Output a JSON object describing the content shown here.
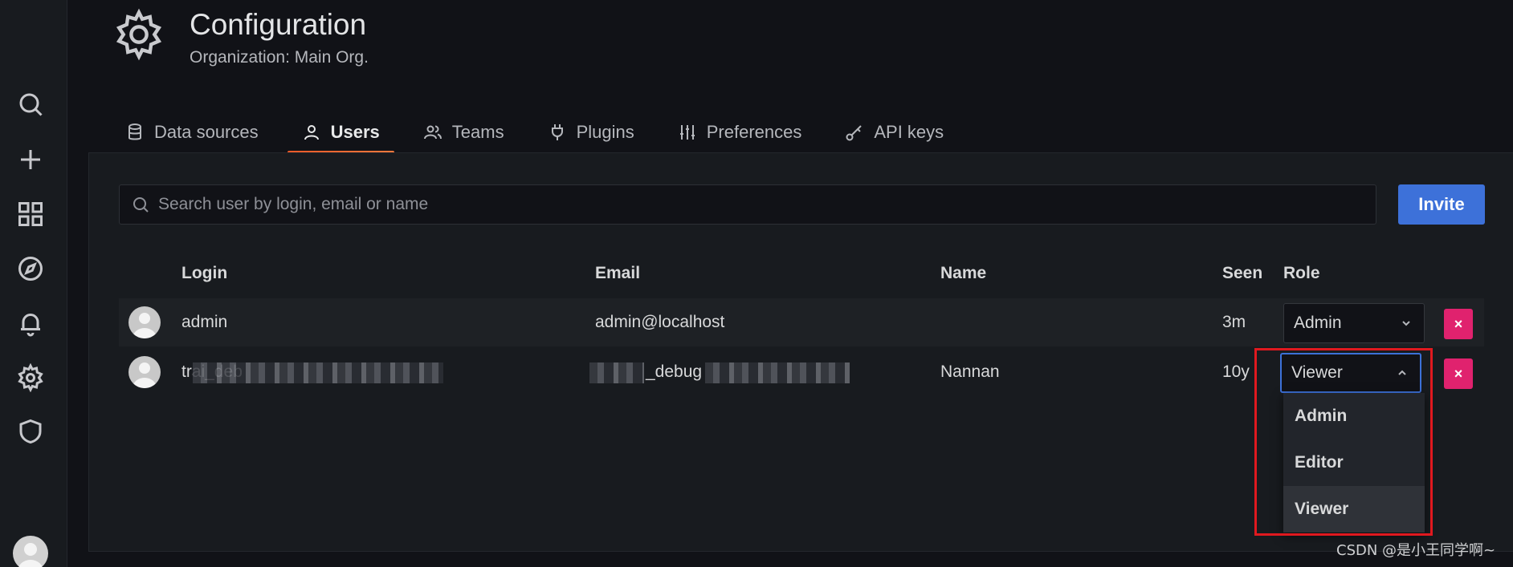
{
  "header": {
    "title": "Configuration",
    "subtitle": "Organization: Main Org."
  },
  "tabs": [
    {
      "label": "Data sources",
      "icon": "database-icon"
    },
    {
      "label": "Users",
      "icon": "user-icon",
      "active": true
    },
    {
      "label": "Teams",
      "icon": "users-icon"
    },
    {
      "label": "Plugins",
      "icon": "plug-icon"
    },
    {
      "label": "Preferences",
      "icon": "sliders-icon"
    },
    {
      "label": "API keys",
      "icon": "key-icon"
    }
  ],
  "search": {
    "placeholder": "Search user by login, email or name"
  },
  "invite_label": "Invite",
  "table": {
    "headers": {
      "login": "Login",
      "email": "Email",
      "name": "Name",
      "seen": "Seen",
      "role": "Role"
    },
    "rows": [
      {
        "login": "admin",
        "email": "admin@localhost",
        "name": "",
        "seen": "3m",
        "role": "Admin"
      },
      {
        "login": "trai_deb",
        "email": "_debug",
        "name": "Nannan",
        "seen": "10y",
        "role": "Viewer"
      }
    ]
  },
  "delete_symbol": "×",
  "role_menu": {
    "options": [
      "Admin",
      "Editor",
      "Viewer"
    ],
    "selected": "Viewer"
  },
  "colors": {
    "accent": "#3d71d9",
    "tab_underline": "#f05a28",
    "delete": "#e0226e",
    "annotation": "#e0191f"
  },
  "watermark": "CSDN @是小王同学啊~"
}
